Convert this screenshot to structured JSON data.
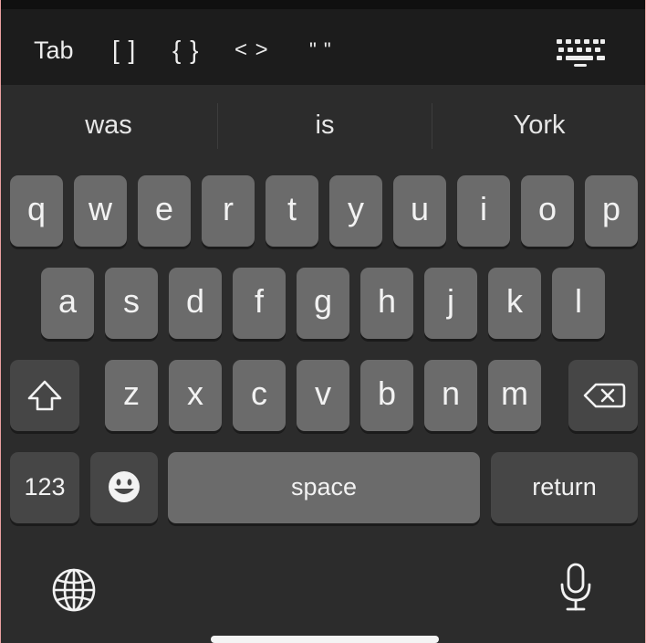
{
  "accessory_bar": {
    "tab_label": "Tab",
    "brackets_label": "[ ]",
    "braces_label": "{ }",
    "angles_label": "< >",
    "quotes_label": "\" \"",
    "dismiss_icon": "keyboard-dismiss-icon"
  },
  "suggestions": [
    "was",
    "is",
    "York"
  ],
  "keyboard": {
    "row1": [
      "q",
      "w",
      "e",
      "r",
      "t",
      "y",
      "u",
      "i",
      "o",
      "p"
    ],
    "row2": [
      "a",
      "s",
      "d",
      "f",
      "g",
      "h",
      "j",
      "k",
      "l"
    ],
    "row3": [
      "z",
      "x",
      "c",
      "v",
      "b",
      "n",
      "m"
    ],
    "shift_icon": "shift-icon",
    "delete_icon": "backspace-icon",
    "numbers_label": "123",
    "emoji_icon": "emoji-icon",
    "space_label": "space",
    "return_label": "return",
    "globe_icon": "globe-icon",
    "mic_icon": "microphone-icon"
  },
  "colors": {
    "key": "#6b6b6b",
    "function_key": "#464646",
    "background": "#2c2c2c",
    "accessory_bar": "#1c1c1c"
  }
}
